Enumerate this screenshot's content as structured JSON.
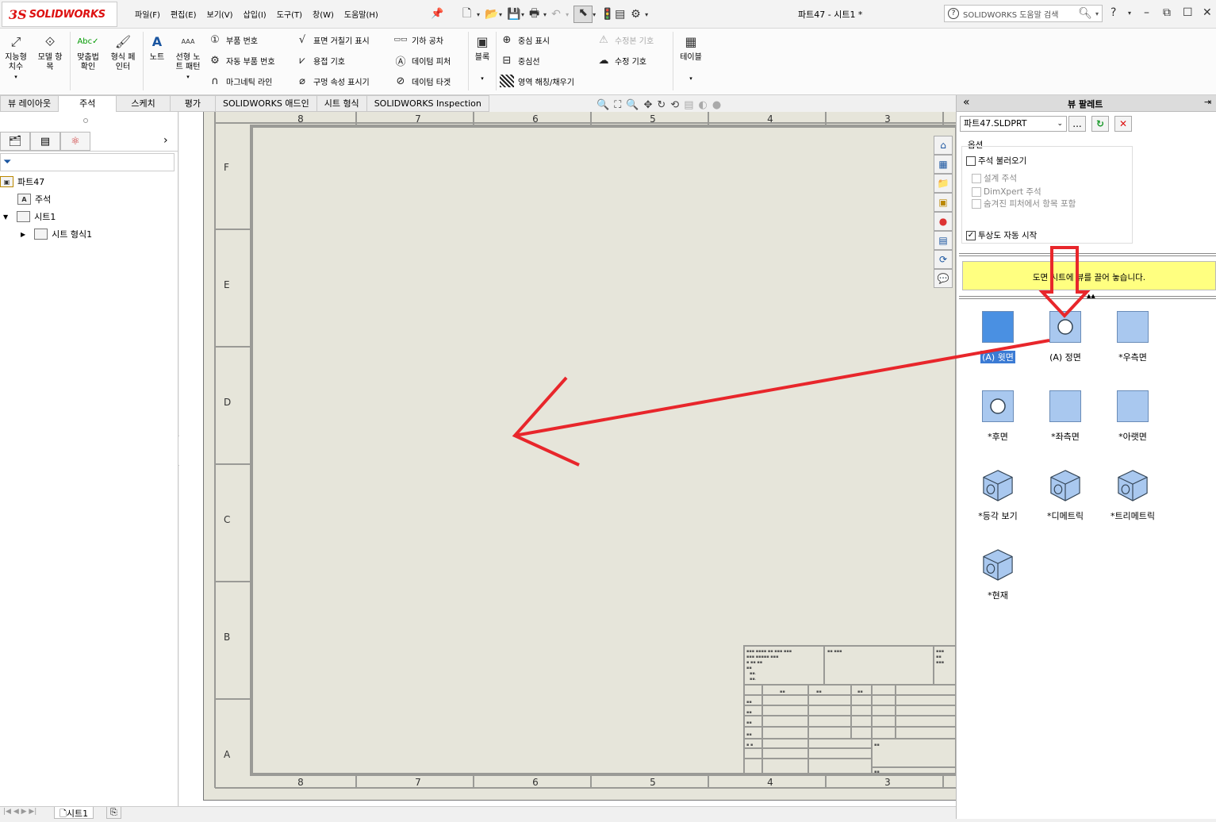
{
  "app": {
    "logo_ds": "3S",
    "logo_text": "SOLIDWORKS",
    "document_title": "파트47 - 시트1 *",
    "search_placeholder": "SOLIDWORKS 도움말 검색",
    "search_glyph": "?"
  },
  "menu": [
    "파일(F)",
    "편집(E)",
    "보기(V)",
    "삽입(I)",
    "도구(T)",
    "창(W)",
    "도움말(H)"
  ],
  "ribbon": {
    "smart_dimension": "지능형\n치수",
    "model_items": "모델 항\n목",
    "spell_check": "맞춤법\n확인",
    "format_painter": "형식 페\n인터",
    "note": "노트",
    "linear_note_pattern": "선형 노\n트 패턴",
    "balloon": "부품 번호",
    "auto_balloon": "자동 부품 번호",
    "magnetic_line": "마그네틱 라인",
    "surface_finish": "표면 거칠기 표시",
    "weld_symbol": "용접 기호",
    "hole_callout": "구멍 속성 표시기",
    "geometric_tolerance": "기하 공차",
    "datum_feature": "데이텀 피처",
    "datum_target": "데이텀 타겟",
    "block": "블록",
    "center_mark": "중심 표시",
    "centerline": "중심선",
    "area_hatch": "영역 해칭/채우기",
    "revision_symbol_disabled": "수정본 기호",
    "revision_cloud": "수정 기호",
    "table": "테이블"
  },
  "tabs": [
    "뷰 레이아웃",
    "주석",
    "스케치",
    "평가",
    "SOLIDWORKS 애드인",
    "시트 형식",
    "SOLIDWORKS Inspection"
  ],
  "active_tab_index": 1,
  "tree": {
    "root": "파트47",
    "annotations": "주석",
    "sheet": "시트1",
    "sheet_format": "시트 형식1"
  },
  "drawing": {
    "col_labels": [
      "8",
      "7",
      "6",
      "5",
      "4",
      "3"
    ],
    "row_labels": [
      "F",
      "E",
      "D",
      "C",
      "B",
      "A"
    ]
  },
  "bottom": {
    "sheet_tab": "시트1"
  },
  "view_palette": {
    "title": "뷰 팔레트",
    "file": "파트47.SLDPRT",
    "browse_label": "...",
    "refresh_glyph": "↻",
    "clear_glyph": "✕",
    "options_label": "옵션",
    "import_annotations": "주석 불러오기",
    "design_annotations": "설계 주석",
    "dimxpert_annotations": "DimXpert 주석",
    "include_hidden": "숨겨진 피처에서 항목 포함",
    "auto_projected": "투상도 자동 시작",
    "auto_projected_checked": true,
    "banner": "도면 시트에 뷰를 끌어 놓습니다.",
    "views": [
      {
        "label": "(A) 윗면",
        "selected": true,
        "shape": "square-dark"
      },
      {
        "label": "(A) 정면",
        "selected": false,
        "shape": "square-circle"
      },
      {
        "label": "*우측면",
        "selected": false,
        "shape": "square"
      },
      {
        "label": "*후면",
        "selected": false,
        "shape": "square-circle"
      },
      {
        "label": "*좌측면",
        "selected": false,
        "shape": "square"
      },
      {
        "label": "*아랫면",
        "selected": false,
        "shape": "square"
      },
      {
        "label": "*등각 보기",
        "selected": false,
        "shape": "cube"
      },
      {
        "label": "*디메트릭",
        "selected": false,
        "shape": "cube"
      },
      {
        "label": "*트리메트릭",
        "selected": false,
        "shape": "cube"
      },
      {
        "label": "*현재",
        "selected": false,
        "shape": "cube"
      }
    ]
  },
  "colors": {
    "sheet_bg": "#e6e5da",
    "view_fill": "#a9c8ef",
    "view_fill_dark": "#4a90e2",
    "annotation_red": "#e8262b",
    "banner": "#ffff80"
  }
}
